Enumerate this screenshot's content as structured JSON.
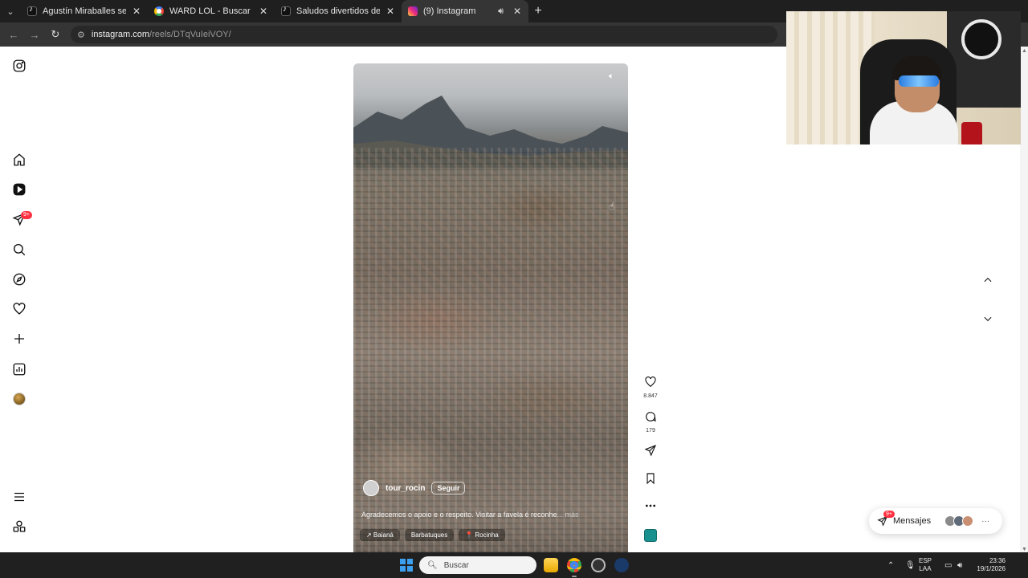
{
  "browser": {
    "tabs": [
      {
        "title": "Agustín Miraballes se consagra",
        "favicon": "tiktok-icon",
        "active": false
      },
      {
        "title": "WARD LOL - Buscar con Google",
        "favicon": "google-icon",
        "active": false
      },
      {
        "title": "Saludos divertidos del mudo p",
        "favicon": "tiktok-icon",
        "active": false
      },
      {
        "title": "(9) Instagram",
        "favicon": "instagram-icon",
        "active": true
      }
    ],
    "url_host": "instagram.com",
    "url_path": "/reels/DTqVuIeiVOY/"
  },
  "sidebar": {
    "notification_badge": "9+",
    "items": [
      "instagram-logo-icon",
      "home-icon",
      "reels-icon",
      "messages-icon",
      "search-icon",
      "explore-icon",
      "notifications-icon",
      "create-icon",
      "dashboard-icon",
      "profile-avatar",
      "menu-icon",
      "meta-apps-icon"
    ]
  },
  "reel": {
    "owner": "tour_rocin",
    "follow_label": "Seguir",
    "caption": "Agradecemos o apoio e o respeito. Visitar a favela é reconhe",
    "caption_more": "... más",
    "tags": [
      "↗ Baianá",
      "Barbatuques",
      "📍 Rocinha"
    ]
  },
  "actions": {
    "likes": "8.847",
    "comments": "179"
  },
  "messages": {
    "label": "Mensajes",
    "badge": "9+"
  },
  "taskbar": {
    "search_placeholder": "Buscar",
    "lang_top": "ESP",
    "lang_bottom": "LAA",
    "time": "23:36",
    "date": "19/1/2026"
  },
  "colors": {
    "badge_red": "#ff3040",
    "audio_thumb": "#17908e"
  }
}
